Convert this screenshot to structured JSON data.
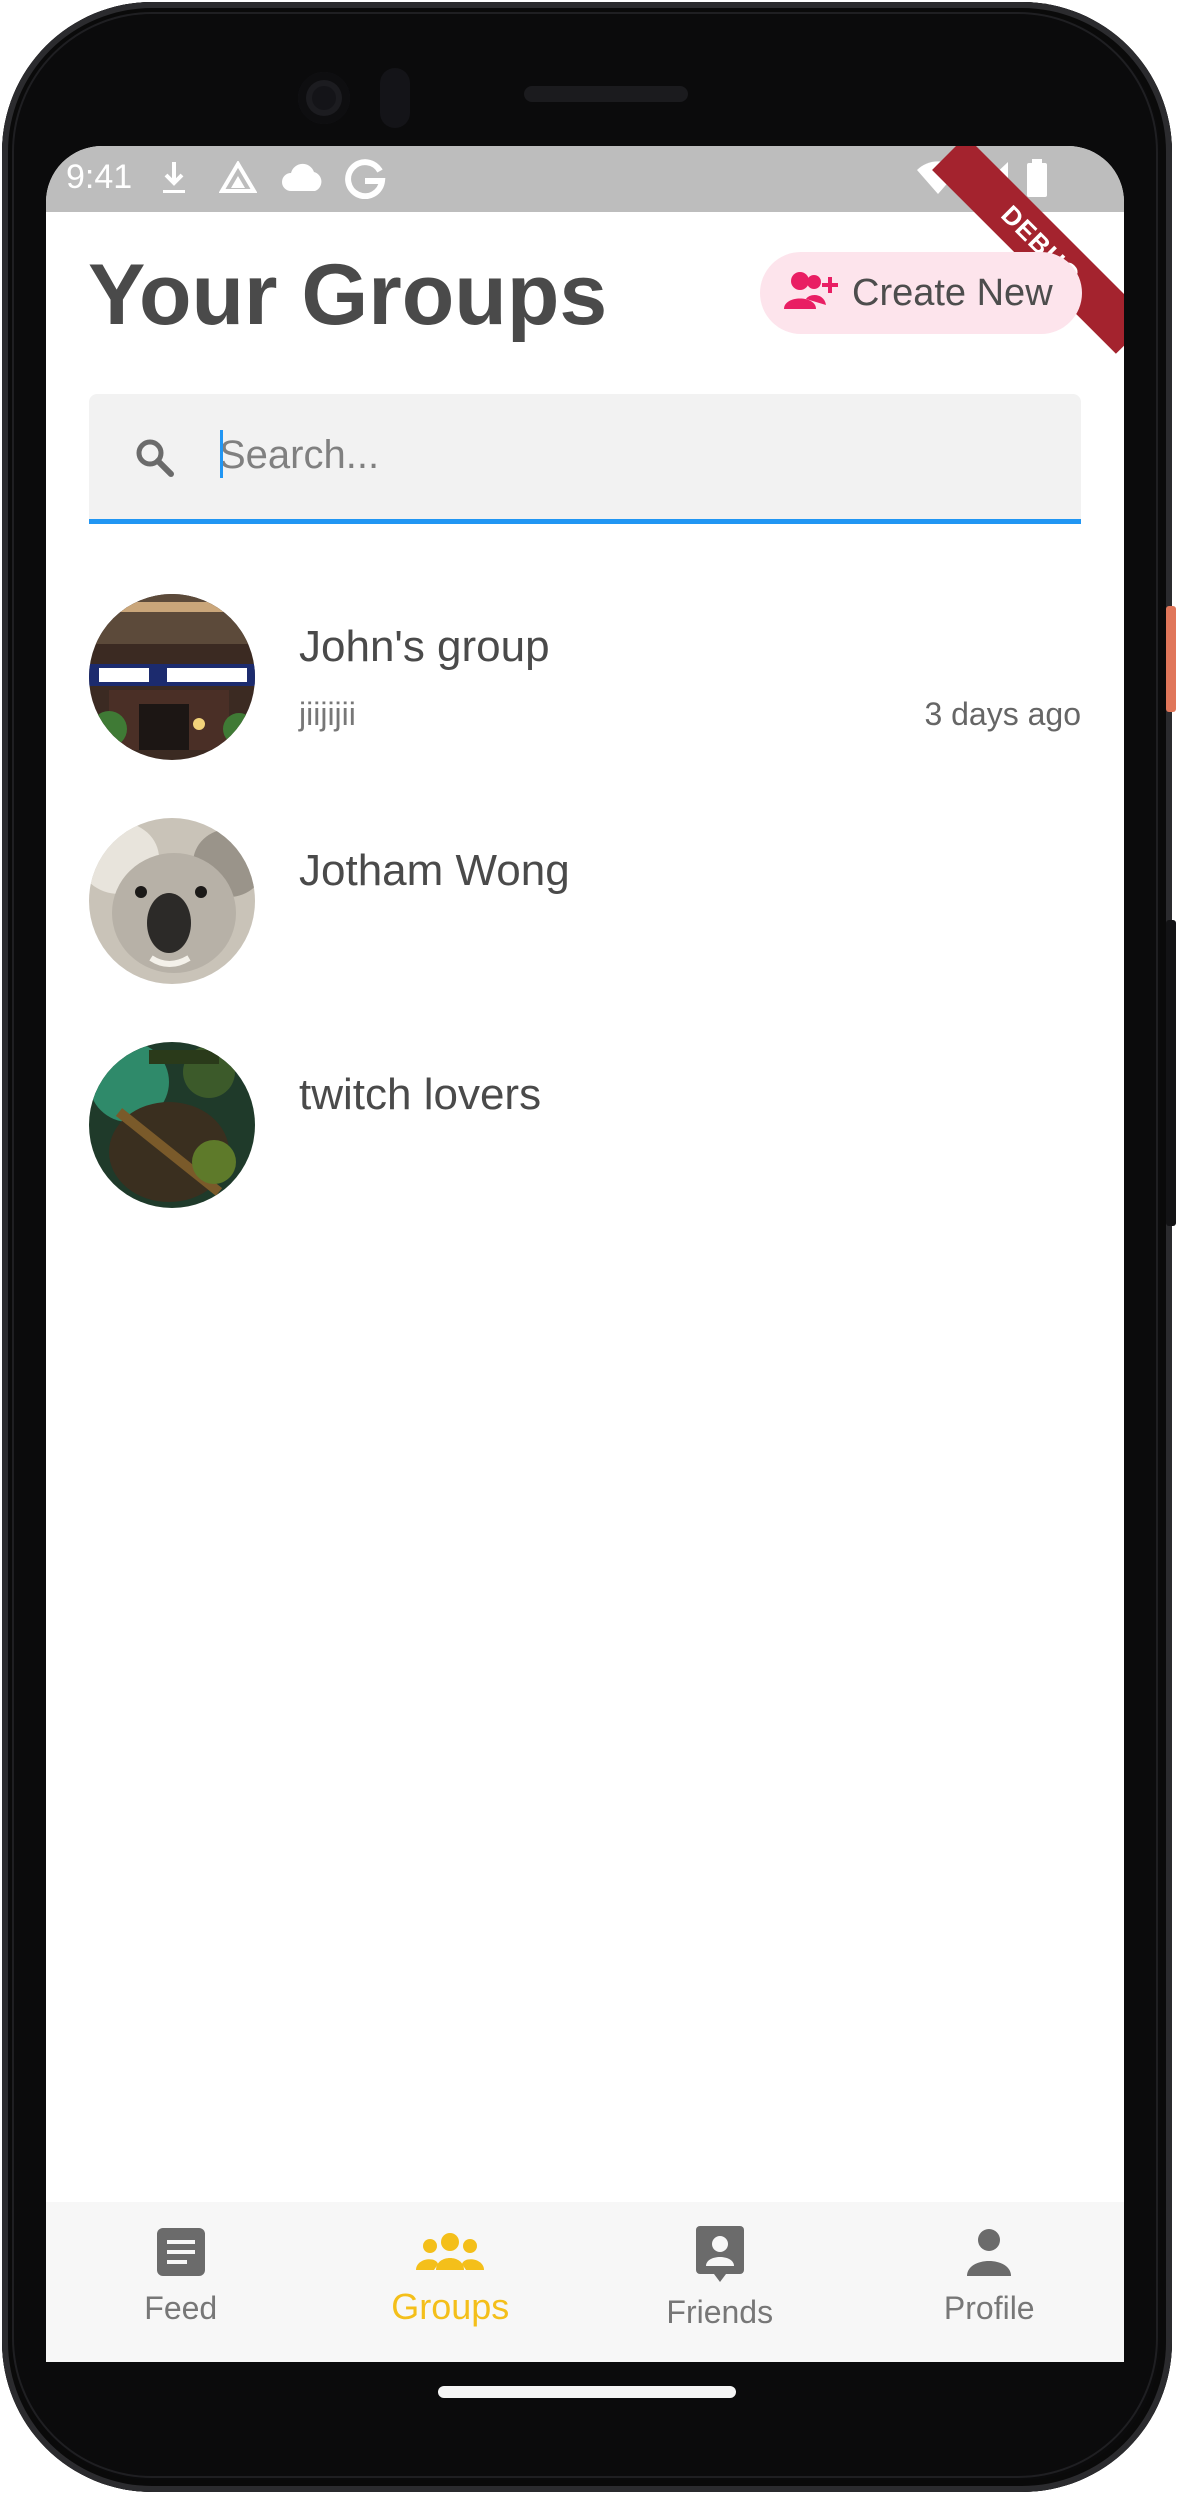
{
  "status_bar": {
    "time": "9:41",
    "icons": [
      "download-icon",
      "drive-icon",
      "cloud-icon",
      "google-g-icon",
      "wifi-icon",
      "signal-icon",
      "battery-icon"
    ]
  },
  "debug_banner": "DEBUG",
  "header": {
    "title": "Your Groups",
    "create_button_label": "Create New",
    "create_button_icon": "add-user-icon",
    "accent": "#e91e63",
    "create_button_bg": "#fde4ec"
  },
  "search": {
    "placeholder": "Search...",
    "value": "",
    "underline_color": "#2196f3"
  },
  "groups": [
    {
      "name": "John's group",
      "subtitle": "jiijijii",
      "time": "3 days ago",
      "avatar": "restaurant-photo"
    },
    {
      "name": "Jotham Wong",
      "subtitle": "",
      "time": "",
      "avatar": "koala-photo"
    },
    {
      "name": "twitch lovers",
      "subtitle": "",
      "time": "",
      "avatar": "game-character-photo"
    }
  ],
  "bottom_nav": {
    "items": [
      {
        "label": "Feed",
        "icon": "article-icon",
        "active": false
      },
      {
        "label": "Groups",
        "icon": "groups-icon",
        "active": true
      },
      {
        "label": "Friends",
        "icon": "contact-card-icon",
        "active": false
      },
      {
        "label": "Profile",
        "icon": "person-icon",
        "active": false
      }
    ],
    "active_color": "#f4bf1a",
    "inactive_color": "#777777"
  }
}
